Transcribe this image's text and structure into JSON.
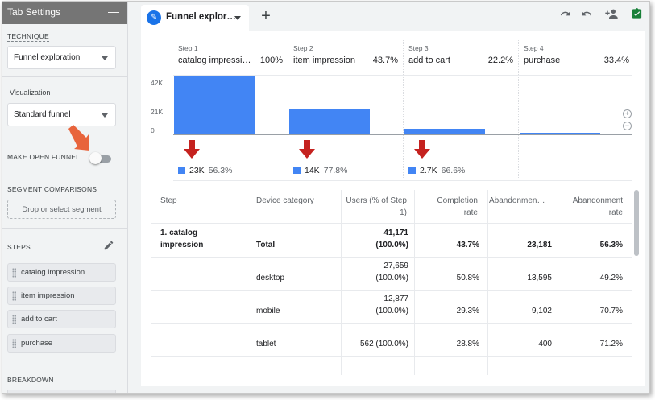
{
  "tab_settings": {
    "title": "Tab Settings",
    "minimize": "—",
    "technique_label": "TECHNIQUE",
    "technique_value": "Funnel exploration",
    "visualization_label": "Visualization",
    "visualization_value": "Standard funnel",
    "open_funnel_label": "MAKE OPEN FUNNEL",
    "segment_label": "SEGMENT COMPARISONS",
    "segment_placeholder": "Drop or select segment",
    "steps_label": "STEPS",
    "steps": [
      "catalog impression",
      "item impression",
      "add to cart",
      "purchase"
    ],
    "breakdown_label": "BREAKDOWN"
  },
  "tab": {
    "label": "Funnel explor…",
    "add": "+"
  },
  "toolbar": {
    "undo_icon": "undo-icon",
    "redo_icon": "redo-icon",
    "share_icon": "add-user-icon",
    "save_icon": "check-icon"
  },
  "funnel": {
    "steps": [
      {
        "num": "Step 1",
        "name": "catalog impressi…",
        "pct": "100%",
        "drop_users": "23K",
        "drop_pct": "56.3%"
      },
      {
        "num": "Step 2",
        "name": "item impression",
        "pct": "43.7%",
        "drop_users": "14K",
        "drop_pct": "77.8%"
      },
      {
        "num": "Step 3",
        "name": "add to cart",
        "pct": "22.2%",
        "drop_users": "2.7K",
        "drop_pct": "66.6%"
      },
      {
        "num": "Step 4",
        "name": "purchase",
        "pct": "33.4%"
      }
    ],
    "y_ticks": [
      "42K",
      "21K",
      "0"
    ]
  },
  "chart_data": {
    "type": "bar",
    "categories": [
      "catalog impression",
      "item impression",
      "add to cart",
      "purchase"
    ],
    "values": [
      41171,
      18000,
      4000,
      1340
    ],
    "ylim": [
      0,
      42000
    ],
    "yticks": [
      "42K",
      "21K",
      "0"
    ]
  },
  "colors": {
    "bar": "#4285f4",
    "drop_arrow": "#c5221f",
    "annotation_arrow": "#e8643c",
    "tab_icon": "#1a73e8",
    "save_icon": "#188038"
  },
  "table": {
    "headers": {
      "step": "Step",
      "device": "Device category",
      "users": "Users (% of Step 1)",
      "completion": "Completion rate",
      "abandon": "Abandonmen…",
      "abandon_rate": "Abandonment rate"
    },
    "rows": [
      {
        "step": "1. catalog impression",
        "device": "Total",
        "users": "41,171",
        "users_pct": "(100.0%)",
        "completion": "43.7%",
        "abandon": "23,181",
        "abandon_rate": "56.3%"
      },
      {
        "step": "",
        "device": "desktop",
        "users": "27,659",
        "users_pct": "(100.0%)",
        "completion": "50.8%",
        "abandon": "13,595",
        "abandon_rate": "49.2%"
      },
      {
        "step": "",
        "device": "mobile",
        "users": "12,877",
        "users_pct": "(100.0%)",
        "completion": "29.3%",
        "abandon": "9,102",
        "abandon_rate": "70.7%"
      },
      {
        "step": "",
        "device": "tablet",
        "users": "562 (100.0%)",
        "users_pct": "",
        "completion": "28.8%",
        "abandon": "400",
        "abandon_rate": "71.2%"
      }
    ]
  }
}
